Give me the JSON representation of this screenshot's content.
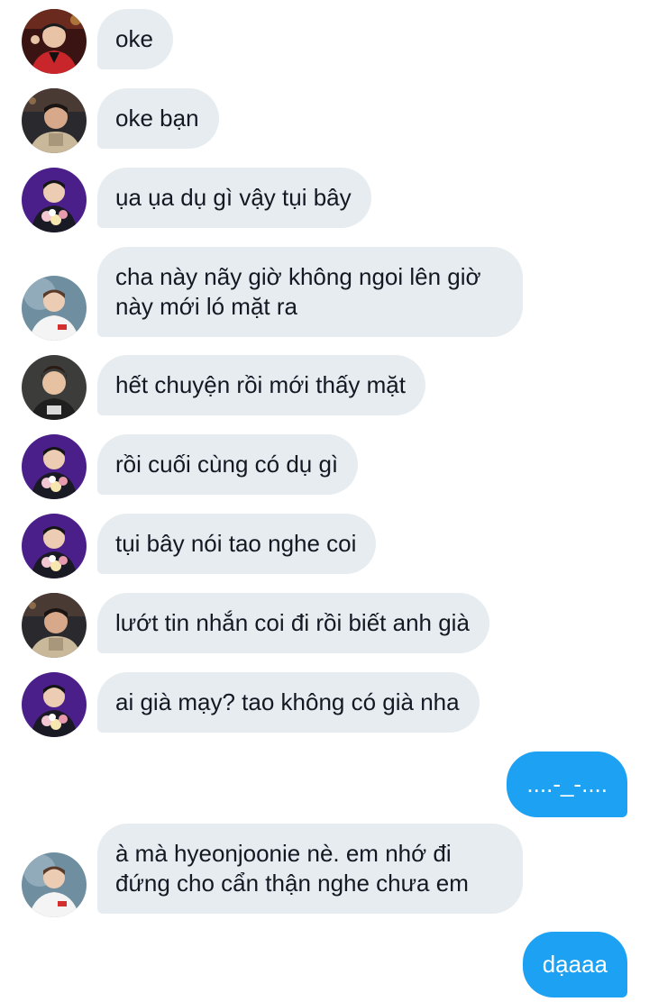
{
  "messages": [
    {
      "sender": "them",
      "avatar_icon": "avatar-red-jersey",
      "text": "oke"
    },
    {
      "sender": "them",
      "avatar_icon": "avatar-dark-hoodie",
      "text": "oke bạn"
    },
    {
      "sender": "them",
      "avatar_icon": "avatar-purple-flowers",
      "text": "ụa ụa dụ gì vậy tụi bây"
    },
    {
      "sender": "them",
      "avatar_icon": "avatar-white-jersey",
      "text": "cha này nãy giờ không ngoi lên giờ này mới ló mặt ra"
    },
    {
      "sender": "them",
      "avatar_icon": "avatar-portrait",
      "text": "hết chuyện rồi mới thấy mặt"
    },
    {
      "sender": "them",
      "avatar_icon": "avatar-purple-flowers",
      "text": "rồi cuối cùng có dụ gì"
    },
    {
      "sender": "them",
      "avatar_icon": "avatar-purple-flowers",
      "text": "tụi bây nói tao nghe coi"
    },
    {
      "sender": "them",
      "avatar_icon": "avatar-dark-hoodie",
      "text": "lướt tin nhắn coi đi rồi biết anh già"
    },
    {
      "sender": "them",
      "avatar_icon": "avatar-purple-flowers",
      "text": "ai già mạy? tao không có già nha"
    },
    {
      "sender": "me",
      "text": "....-_-...."
    },
    {
      "sender": "them",
      "avatar_icon": "avatar-white-jersey",
      "text": "à mà hyeonjoonie nè. em nhớ đi đứng cho cẩn thận nghe chưa em"
    },
    {
      "sender": "me",
      "text": "dạaaa"
    }
  ],
  "colors": {
    "incoming_bubble": "#e6ecf0",
    "outgoing_bubble": "#1da1f2",
    "incoming_text": "#141823",
    "outgoing_text": "#ffffff"
  }
}
